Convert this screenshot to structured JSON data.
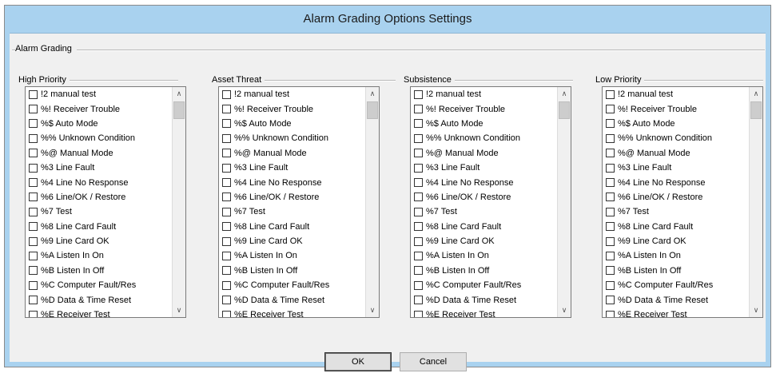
{
  "window": {
    "title": "Alarm Grading Options Settings"
  },
  "group": {
    "title": "Alarm Grading"
  },
  "columns": [
    {
      "label": "High Priority"
    },
    {
      "label": "Asset Threat"
    },
    {
      "label": "Subsistence"
    },
    {
      "label": "Low Priority"
    }
  ],
  "items": [
    "!2  manual test",
    "%!  Receiver Trouble",
    "%$  Auto Mode",
    "%%  Unknown Condition",
    "%@  Manual Mode",
    "%3  Line Fault",
    "%4  Line No Response",
    "%6  Line/OK / Restore",
    "%7  Test",
    "%8  Line Card Fault",
    "%9  Line Card OK",
    "%A  Listen In On",
    "%B  Listen In Off",
    "%C  Computer Fault/Res",
    "%D  Data & Time Reset",
    "%E  Receiver Test"
  ],
  "checked": false,
  "buttons": {
    "ok": "OK",
    "cancel": "Cancel"
  },
  "colors": {
    "title_bar": "#a9d2ef",
    "dialog_bg": "#f0f0f0"
  }
}
